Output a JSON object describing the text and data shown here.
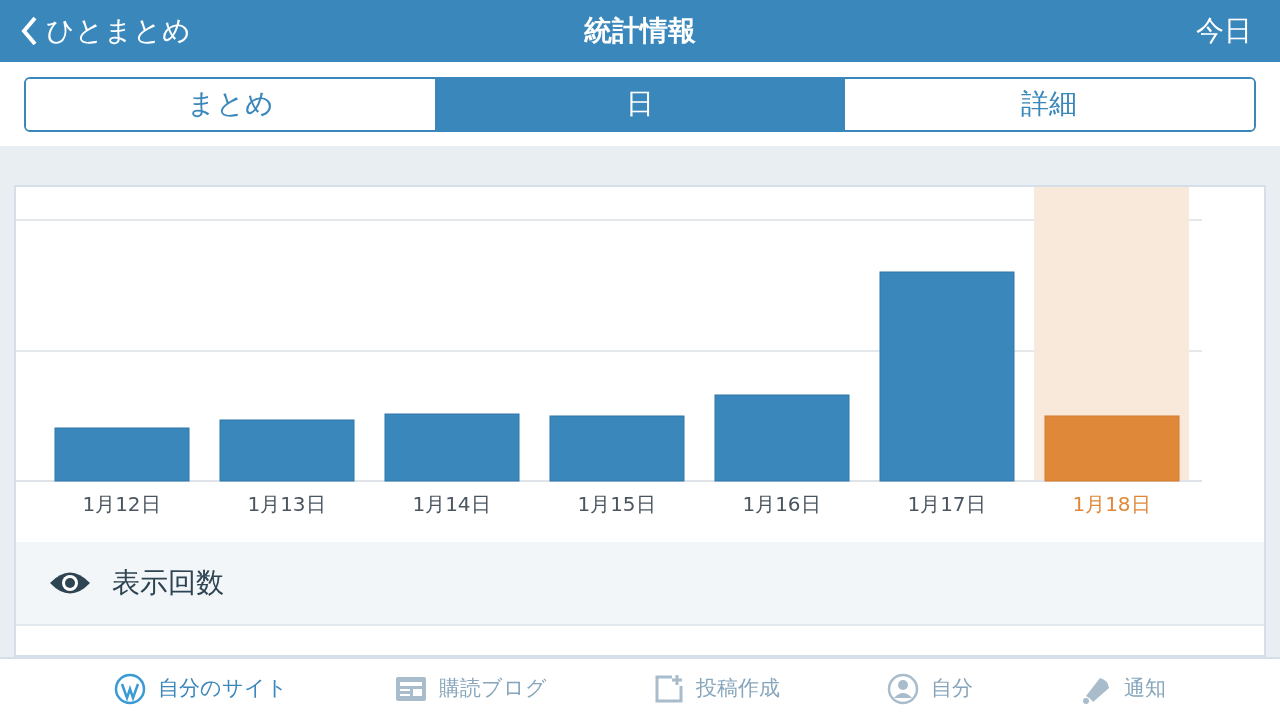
{
  "header": {
    "back": "ひとまとめ",
    "title": "統計情報",
    "action": "今日"
  },
  "tabs": [
    {
      "label": "まとめ",
      "selected": false
    },
    {
      "label": "日",
      "selected": true
    },
    {
      "label": "詳細",
      "selected": false
    }
  ],
  "chart": {
    "categories": [
      {
        "label": "1月12日",
        "selected": false
      },
      {
        "label": "1月13日",
        "selected": false
      },
      {
        "label": "1月14日",
        "selected": false
      },
      {
        "label": "1月15日",
        "selected": false
      },
      {
        "label": "1月16日",
        "selected": false
      },
      {
        "label": "1月17日",
        "selected": false
      },
      {
        "label": "1月18日",
        "selected": true
      }
    ]
  },
  "stats": [
    {
      "label": "表示回数"
    }
  ],
  "tab_bar": [
    {
      "label": "自分のサイト",
      "kind": "sites",
      "selected": true
    },
    {
      "label": "購読ブログ",
      "kind": "reader",
      "selected": false
    },
    {
      "label": "投稿作成",
      "kind": "write",
      "selected": false
    },
    {
      "label": "自分",
      "kind": "me",
      "selected": false
    },
    {
      "label": "通知",
      "kind": "notifications",
      "selected": false
    }
  ]
}
